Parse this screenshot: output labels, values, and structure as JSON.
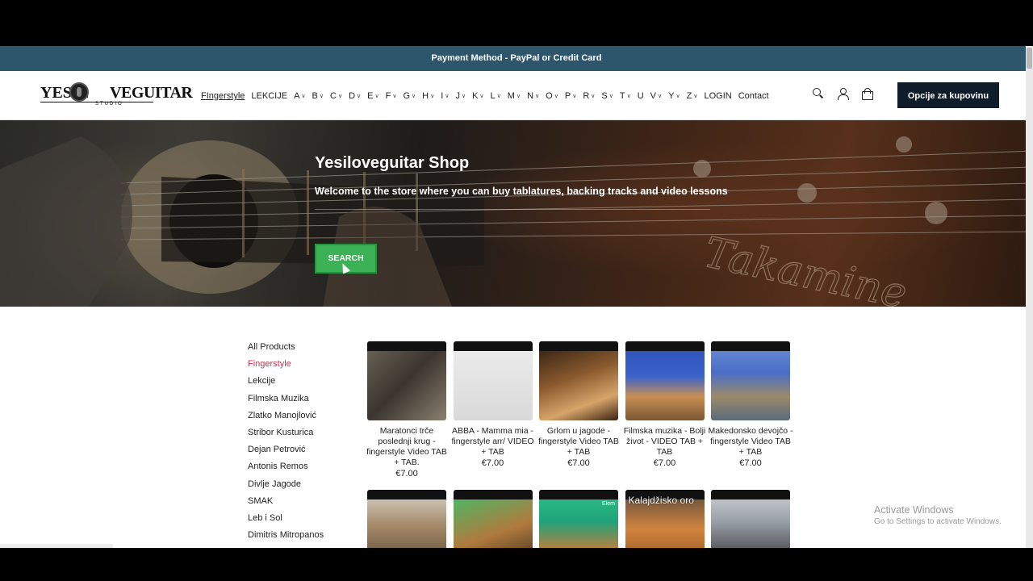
{
  "announcement": "Payment Method - PayPal or Credit Card",
  "logo": {
    "main": "YESILOVEGUITAR",
    "sub": "STUDIO"
  },
  "nav": [
    {
      "label": "FIngerstyle",
      "chevron": false,
      "active": true
    },
    {
      "label": "LEKCIJE",
      "chevron": false
    },
    {
      "label": "A",
      "chevron": true
    },
    {
      "label": "B",
      "chevron": true
    },
    {
      "label": "C",
      "chevron": true
    },
    {
      "label": "D",
      "chevron": true
    },
    {
      "label": "E",
      "chevron": true
    },
    {
      "label": "F",
      "chevron": true
    },
    {
      "label": "G",
      "chevron": true
    },
    {
      "label": "H",
      "chevron": true
    },
    {
      "label": "I",
      "chevron": true
    },
    {
      "label": "J",
      "chevron": true
    },
    {
      "label": "K",
      "chevron": true
    },
    {
      "label": "L",
      "chevron": true
    },
    {
      "label": "M",
      "chevron": true
    },
    {
      "label": "N",
      "chevron": true
    },
    {
      "label": "O",
      "chevron": true
    },
    {
      "label": "P",
      "chevron": true
    },
    {
      "label": "R",
      "chevron": true
    },
    {
      "label": "S",
      "chevron": true
    },
    {
      "label": "T",
      "chevron": true
    },
    {
      "label": "U",
      "chevron": false
    },
    {
      "label": "V",
      "chevron": true
    },
    {
      "label": "Y",
      "chevron": true
    },
    {
      "label": "Z",
      "chevron": true
    },
    {
      "label": "LOGIN",
      "chevron": false
    },
    {
      "label": "Contact",
      "chevron": false
    }
  ],
  "header_icons": [
    "search-icon",
    "account-icon",
    "cart-icon"
  ],
  "cta_label": "Opcije za kupovinu",
  "hero": {
    "title": "Yesiloveguitar Shop",
    "subtitle": "Welcome to the store where you can buy tablatures, backing tracks and video lessons",
    "button": "SEARCH"
  },
  "sidebar": [
    {
      "label": "All Products"
    },
    {
      "label": "Fingerstyle",
      "active": true
    },
    {
      "label": "Lekcije"
    },
    {
      "label": "Filmska Muzika"
    },
    {
      "label": "Zlatko Manojlović"
    },
    {
      "label": "Stribor Kusturica"
    },
    {
      "label": "Dejan Petrović"
    },
    {
      "label": "Antonis Remos"
    },
    {
      "label": "Divlje Jagode"
    },
    {
      "label": "SMAK"
    },
    {
      "label": "Leb i Sol"
    },
    {
      "label": "Dimitris Mitropanos"
    }
  ],
  "products": [
    {
      "title": "Maratonci trče poslednji krug - fingerstyle Video TAB + TAB.",
      "price": "€7.00",
      "thumb_style": "sepia-closeup"
    },
    {
      "title": "ABBA - Mamma mia - fingerstyle arr/ VIDEO + TAB",
      "price": "€7.00",
      "thumb_style": "bw-player"
    },
    {
      "title": "Grlom u jagode - fingerstyle Video TAB + TAB",
      "price": "€7.00",
      "thumb_style": "warm-closeup"
    },
    {
      "title": "Filmska muzika - Bolji život - VIDEO TAB + TAB",
      "price": "€7.00",
      "thumb_style": "blue-shirt"
    },
    {
      "title": "Makedonsko devojčo - fingerstyle Video TAB + TAB",
      "price": "€7.00",
      "thumb_style": "blue-shirt-2"
    },
    {
      "title": "",
      "price": "",
      "thumb_style": "neck-closeup"
    },
    {
      "title": "",
      "price": "",
      "thumb_style": "green-screen"
    },
    {
      "title": "",
      "price": "",
      "thumb_style": "green-player",
      "overlay": "Elem"
    },
    {
      "title": "",
      "price": "",
      "thumb_style": "orange-guitar",
      "overlay": "Kalajdžisko oro"
    },
    {
      "title": "",
      "price": "",
      "thumb_style": "dark-neck"
    }
  ],
  "watermark": {
    "line1": "Activate Windows",
    "line2": "Go to Settings to activate Windows."
  }
}
